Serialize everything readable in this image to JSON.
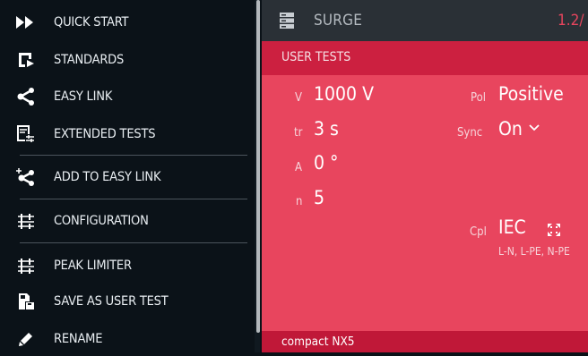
{
  "menu": {
    "items": [
      {
        "label": "QUICK START",
        "icon": "fast-forward-icon"
      },
      {
        "label": "STANDARDS",
        "icon": "standards-icon"
      },
      {
        "label": "EASY LINK",
        "icon": "share-icon"
      },
      {
        "label": "EXTENDED TESTS",
        "icon": "extended-tests-icon"
      },
      {
        "label": "ADD TO EASY LINK",
        "icon": "share-add-icon"
      },
      {
        "label": "CONFIGURATION",
        "icon": "sliders-icon"
      },
      {
        "label": "PEAK LIMITER",
        "icon": "sliders-icon"
      },
      {
        "label": "SAVE AS USER TEST",
        "icon": "save-doc-icon"
      },
      {
        "label": "RENAME",
        "icon": "pencil-icon"
      }
    ]
  },
  "panel": {
    "title": "SURGE",
    "page": "1.2/",
    "section": "USER TESTS",
    "params": {
      "v": {
        "label": "V",
        "value": "1000 V"
      },
      "tr": {
        "label": "tr",
        "value": "3 s"
      },
      "a": {
        "label": "A",
        "value": "0 °"
      },
      "n": {
        "label": "n",
        "value": "5"
      },
      "pol": {
        "label": "Pol",
        "value": "Positive"
      },
      "sync": {
        "label": "Sync",
        "value": "On"
      },
      "cpl": {
        "label": "Cpl",
        "value": "IEC",
        "sub": "L-N, L-PE, N-PE"
      }
    },
    "device": "compact NX5"
  },
  "colors": {
    "menu_bg": "#0b1218",
    "panel_bg": "#e8455e",
    "subheader": "#cc2040",
    "header": "#2a3036"
  }
}
